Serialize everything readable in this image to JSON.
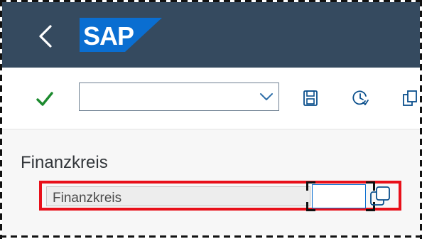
{
  "shell": {
    "logo_text": "SAP",
    "brand_color": "#0a6ed1",
    "header_color": "#354a5f",
    "back_icon": "chevron-left-icon"
  },
  "toolbar": {
    "ok_icon": "checkmark-icon",
    "command_value": "",
    "dropdown_icon": "chevron-down-icon",
    "icons": [
      "save-icon",
      "history-icon",
      "copy-icon"
    ]
  },
  "form": {
    "group_title": "Finanzkreis",
    "field_label": "Finanzkreis",
    "field_value": "",
    "help_icon": "value-help-icon",
    "highlight_color": "#e8101a"
  }
}
